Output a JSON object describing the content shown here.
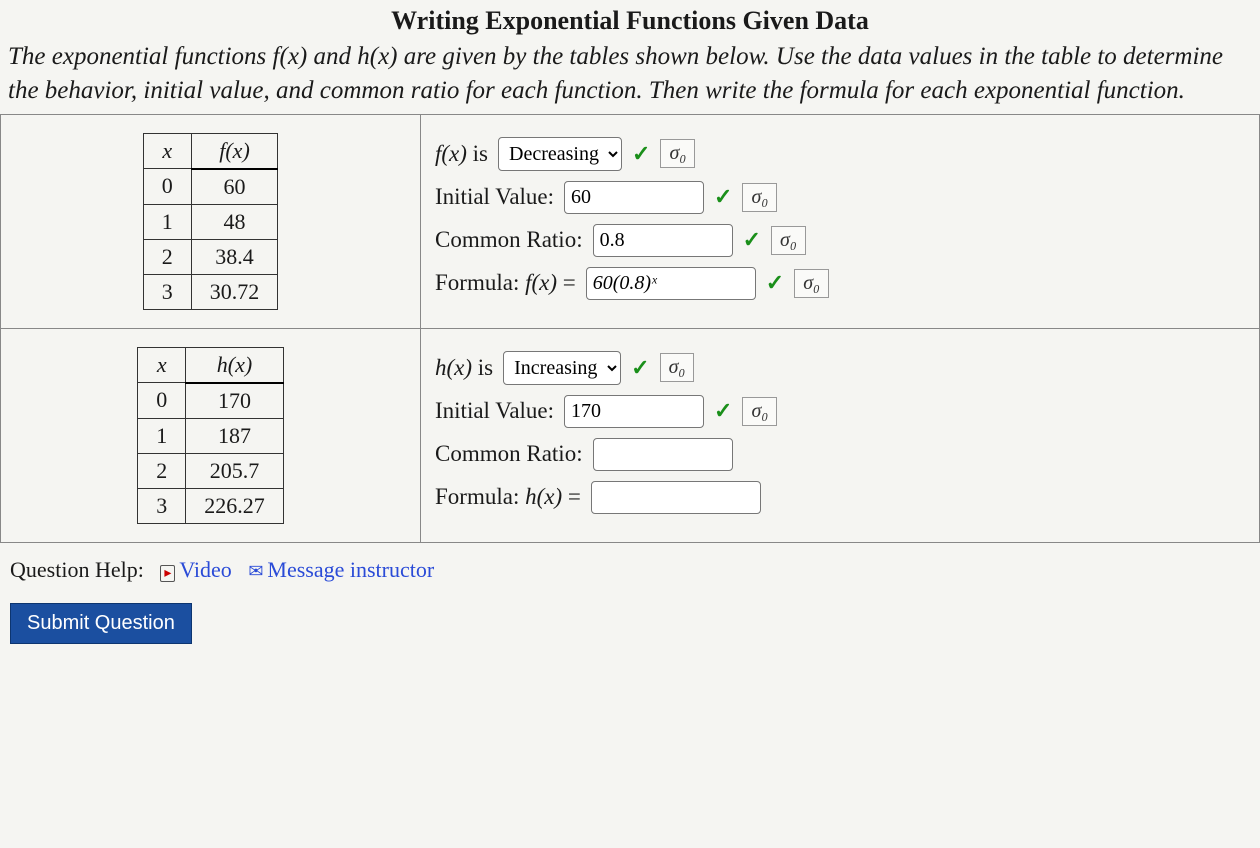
{
  "title": "Writing Exponential Functions Given Data",
  "prompt_parts": {
    "a": "The exponential functions ",
    "fx": "f(x)",
    "b": " and ",
    "hx": "h(x)",
    "c": " are given by the tables shown below. Use the data values in the table to determine the behavior, initial value, and common ratio for each function. Then write the formula for each exponential function."
  },
  "table_f": {
    "head_x": "x",
    "head_fx": "f(x)",
    "rows": [
      {
        "x": "0",
        "y": "60"
      },
      {
        "x": "1",
        "y": "48"
      },
      {
        "x": "2",
        "y": "38.4"
      },
      {
        "x": "3",
        "y": "30.72"
      }
    ]
  },
  "table_h": {
    "head_x": "x",
    "head_hx": "h(x)",
    "rows": [
      {
        "x": "0",
        "y": "170"
      },
      {
        "x": "1",
        "y": "187"
      },
      {
        "x": "2",
        "y": "205.7"
      },
      {
        "x": "3",
        "y": "226.27"
      }
    ]
  },
  "f_panel": {
    "behavior_label_a": "f(x)",
    "behavior_label_b": " is ",
    "behavior_value": "Decreasing",
    "initial_label": "Initial Value: ",
    "initial_value": "60",
    "ratio_label": "Common Ratio: ",
    "ratio_value": "0.8",
    "formula_label_a": "Formula: ",
    "formula_label_b": "f(x)",
    "formula_label_c": " = ",
    "formula_value": "60(0.8)ˣ"
  },
  "h_panel": {
    "behavior_label_a": "h(x)",
    "behavior_label_b": " is ",
    "behavior_value": "Increasing",
    "initial_label": "Initial Value: ",
    "initial_value": "170",
    "ratio_label": "Common Ratio: ",
    "ratio_value": "",
    "formula_label_a": "Formula: ",
    "formula_label_b": "h(x)",
    "formula_label_c": " = ",
    "formula_value": ""
  },
  "sigma": "σ₀",
  "check": "✓",
  "help": {
    "label": "Question Help:",
    "video": "Video",
    "message": "Message instructor"
  },
  "submit": "Submit Question"
}
